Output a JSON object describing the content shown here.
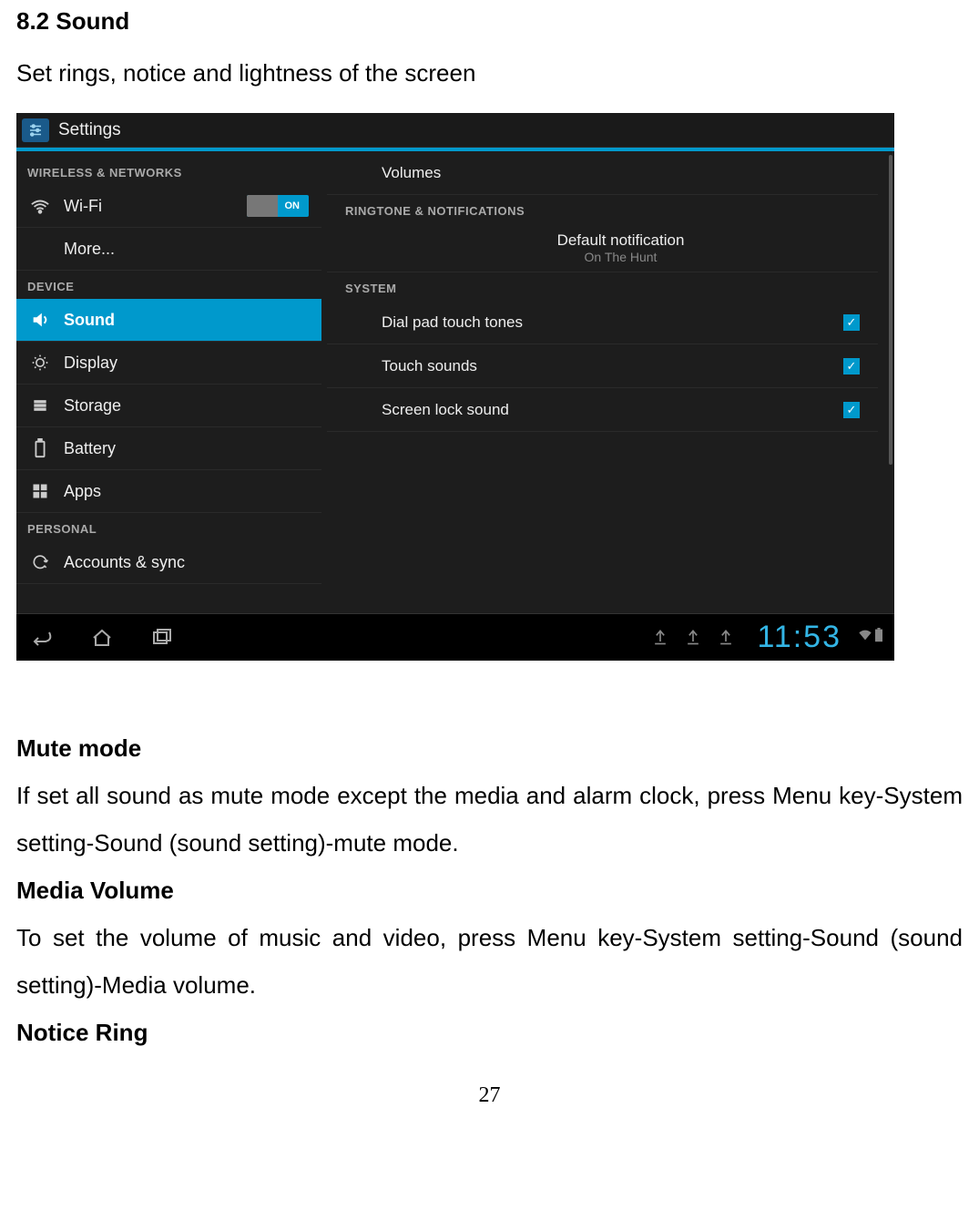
{
  "doc": {
    "heading": "8.2 Sound",
    "intro": "Set rings, notice and lightness of the screen",
    "mute_h": "Mute mode",
    "mute_p": "If set all sound as mute mode except the media and alarm clock, press Menu key-System setting-Sound (sound setting)-mute mode.",
    "media_h": "Media Volume",
    "media_p": "To set the volume of music and video, press Menu key-System setting-Sound (sound setting)-Media volume.",
    "notice_h": "Notice Ring",
    "page": "27"
  },
  "screenshot": {
    "title": "Settings",
    "sidebar": {
      "cat1": "WIRELESS & NETWORKS",
      "wifi": "Wi-Fi",
      "wifi_toggle": "ON",
      "more": "More...",
      "cat2": "DEVICE",
      "sound": "Sound",
      "display": "Display",
      "storage": "Storage",
      "battery": "Battery",
      "apps": "Apps",
      "cat3": "PERSONAL",
      "accounts": "Accounts & sync"
    },
    "content": {
      "volumes": "Volumes",
      "cat_ring": "RINGTONE & NOTIFICATIONS",
      "default_notif": "Default notification",
      "default_notif_sub": "On The Hunt",
      "cat_system": "SYSTEM",
      "dialpad": "Dial pad touch tones",
      "touch": "Touch sounds",
      "screenlock": "Screen lock sound"
    },
    "navbar": {
      "time": "11:53"
    }
  }
}
